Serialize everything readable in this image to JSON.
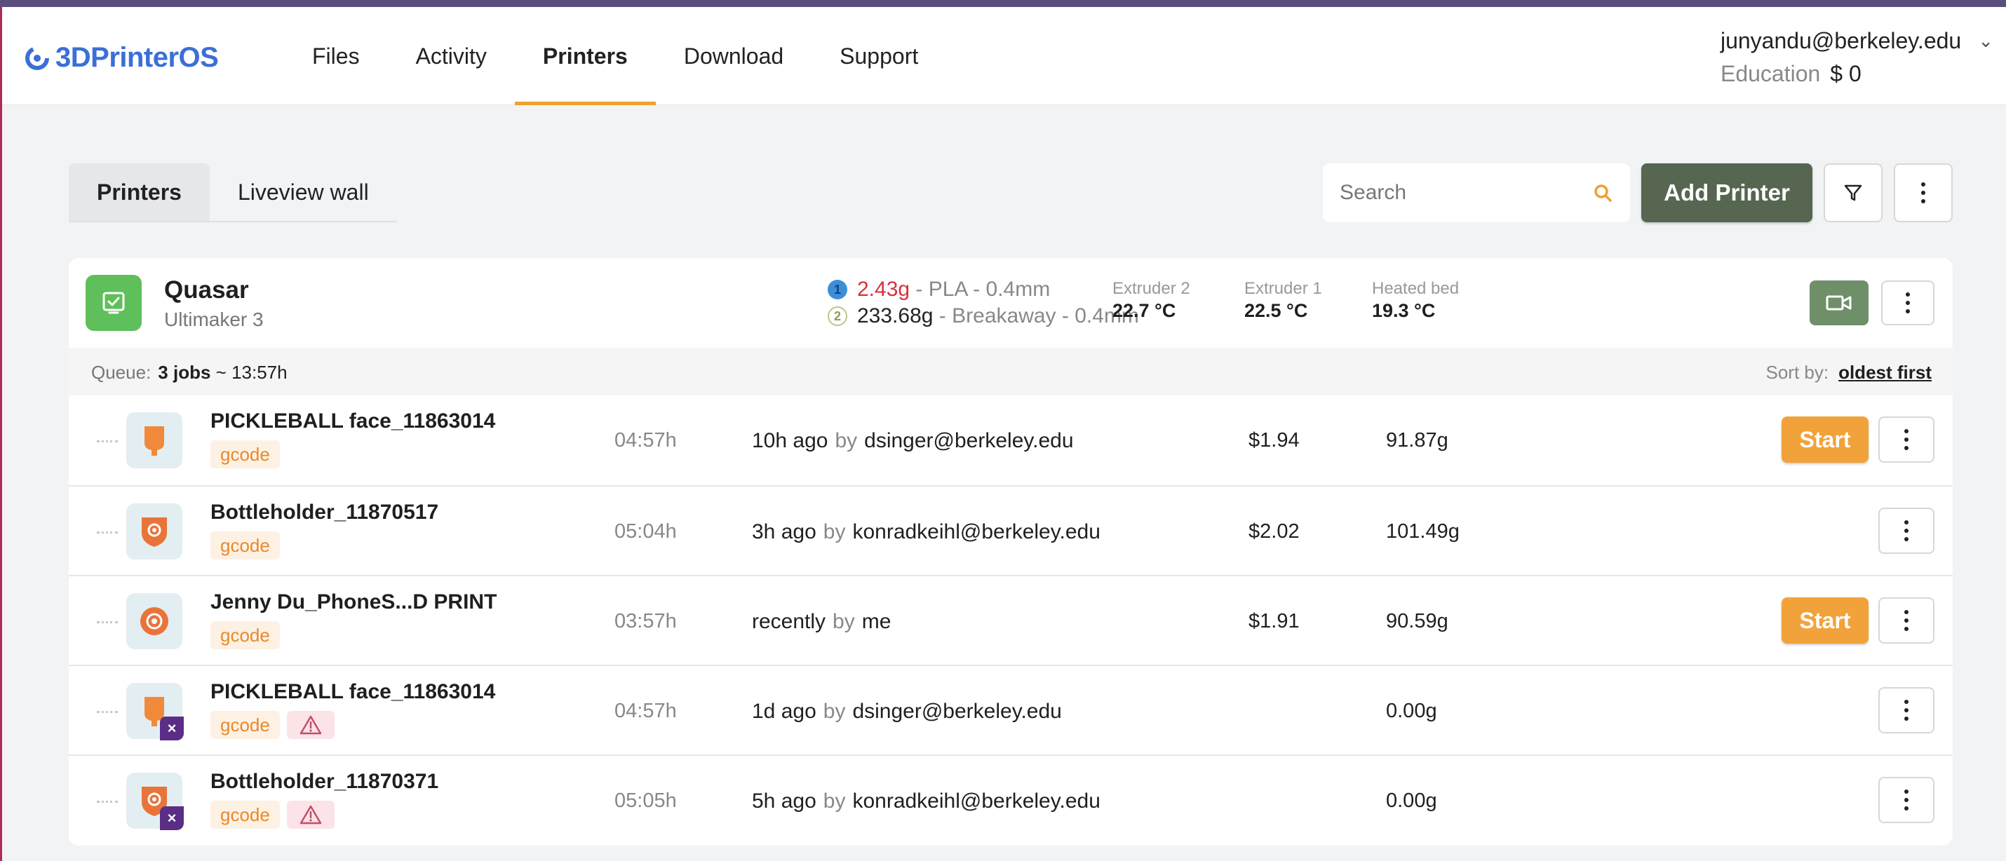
{
  "app": {
    "name": "3DPrinterOS"
  },
  "nav": {
    "items": [
      {
        "label": "Files",
        "active": false
      },
      {
        "label": "Activity",
        "active": false
      },
      {
        "label": "Printers",
        "active": true
      },
      {
        "label": "Download",
        "active": false
      },
      {
        "label": "Support",
        "active": false
      }
    ]
  },
  "user": {
    "email": "junyandu@berkeley.edu",
    "plan": "Education",
    "balance": "$ 0"
  },
  "toolbar": {
    "tabs": [
      {
        "label": "Printers",
        "active": true
      },
      {
        "label": "Liveview wall",
        "active": false
      }
    ],
    "search_placeholder": "Search",
    "add_printer_label": "Add Printer",
    "icons": {
      "search": "search-icon",
      "filter": "filter-icon",
      "more": "more-vertical-icon"
    }
  },
  "printer": {
    "name": "Quasar",
    "model": "Ultimaker 3",
    "status_icon": "check-icon",
    "status_color": "#5fbf5a",
    "materials": [
      {
        "slot": "1",
        "weight": "2.43g",
        "material": "PLA",
        "nozzle": "0.4mm",
        "weight_color": "#d9303a"
      },
      {
        "slot": "2",
        "weight": "233.68g",
        "material": "Breakaway",
        "nozzle": "0.4mm",
        "weight_color": "#222222"
      }
    ],
    "temps": [
      {
        "label": "Extruder 2",
        "value": "22.7 °C"
      },
      {
        "label": "Extruder 1",
        "value": "22.5 °C"
      },
      {
        "label": "Heated bed",
        "value": "19.3 °C"
      }
    ],
    "separator": "-"
  },
  "queue": {
    "label": "Queue:",
    "jobs": "3 jobs",
    "time": "~ 13:57h",
    "sort_label": "Sort by:",
    "sort_value": "oldest first"
  },
  "jobs": [
    {
      "name": "PICKLEBALL face_11863014",
      "tag": "gcode",
      "warning": false,
      "failed": false,
      "thumb": "paddle",
      "duration": "04:57h",
      "when": "10h ago",
      "by_word": "by",
      "by": "dsinger@berkeley.edu",
      "cost": "$1.94",
      "weight": "91.87g",
      "start": "Start"
    },
    {
      "name": "Bottleholder_11870517",
      "tag": "gcode",
      "warning": false,
      "failed": false,
      "thumb": "shield",
      "duration": "05:04h",
      "when": "3h ago",
      "by_word": "by",
      "by": "konradkeihl@berkeley.edu",
      "cost": "$2.02",
      "weight": "101.49g",
      "start": ""
    },
    {
      "name": "Jenny Du_PhoneS...D PRINT",
      "tag": "gcode",
      "warning": false,
      "failed": false,
      "thumb": "disc",
      "duration": "03:57h",
      "when": "recently",
      "by_word": "by",
      "by": "me",
      "cost": "$1.91",
      "weight": "90.59g",
      "start": "Start"
    },
    {
      "name": "PICKLEBALL face_11863014",
      "tag": "gcode",
      "warning": true,
      "failed": true,
      "thumb": "paddle",
      "duration": "04:57h",
      "when": "1d ago",
      "by_word": "by",
      "by": "dsinger@berkeley.edu",
      "cost": "",
      "weight": "0.00g",
      "start": ""
    },
    {
      "name": "Bottleholder_11870371",
      "tag": "gcode",
      "warning": true,
      "failed": true,
      "thumb": "shield",
      "duration": "05:05h",
      "when": "5h ago",
      "by_word": "by",
      "by": "konradkeihl@berkeley.edu",
      "cost": "",
      "weight": "0.00g",
      "start": ""
    }
  ],
  "colors": {
    "accent": "#f0a030",
    "primary_button": "#566650",
    "start_button": "#f2a23a",
    "failed_badge": "#5a2d86"
  }
}
